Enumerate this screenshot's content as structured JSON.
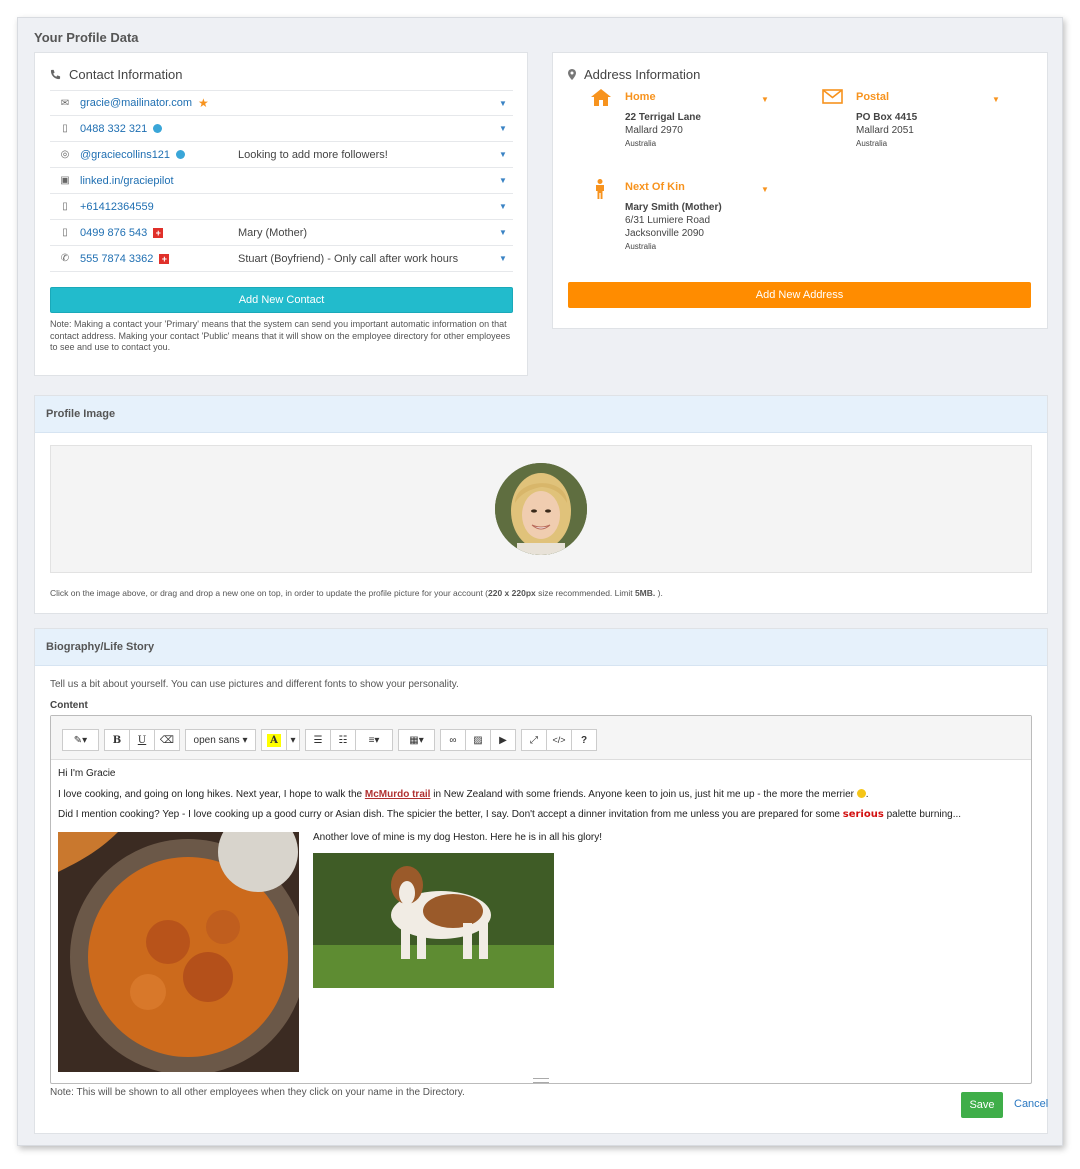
{
  "page": {
    "title": "Your Profile Data"
  },
  "contact": {
    "heading": "Contact Information",
    "rows": [
      {
        "icon": "envelope-icon",
        "value": "gracie@mailinator.com",
        "badge": "star",
        "note": ""
      },
      {
        "icon": "mobile-icon",
        "value": "0488 332 321",
        "badge": "globe",
        "note": ""
      },
      {
        "icon": "instagram-icon",
        "value": "@graciecollins121",
        "badge": "globe",
        "note": "Looking to add more followers!"
      },
      {
        "icon": "linkedin-icon",
        "value": "linked.in/graciepilot",
        "badge": "",
        "note": ""
      },
      {
        "icon": "mobile-icon",
        "value": "+61412364559",
        "badge": "",
        "note": ""
      },
      {
        "icon": "mobile-icon",
        "value": "0499 876 543",
        "badge": "emergency",
        "note": "Mary (Mother)"
      },
      {
        "icon": "phone-icon",
        "value": "555 7874 3362",
        "badge": "emergency",
        "note": "Stuart (Boyfriend) - Only call after work hours"
      }
    ],
    "add_button": "Add New Contact",
    "note": "Note: Making a contact your 'Primary' means that the system can send you important automatic information on that contact address. Making your contact 'Public' means that it will show on the employee directory for other employees to see and use to contact you."
  },
  "address": {
    "heading": "Address Information",
    "home": {
      "title": "Home",
      "line1": "22 Terrigal Lane",
      "line2": "Mallard 2970",
      "country": "Australia"
    },
    "postal": {
      "title": "Postal",
      "line1": "PO Box 4415",
      "line2": "Mallard 2051",
      "country": "Australia"
    },
    "kin": {
      "title": "Next Of Kin",
      "line1": "Mary Smith (Mother)",
      "line2": "6/31 Lumiere Road",
      "line3": "Jacksonville 2090",
      "country": "Australia"
    },
    "add_button": "Add New Address"
  },
  "profile_image": {
    "heading": "Profile Image",
    "help_prefix": "Click on the image above, or drag and drop a new one on top, in order to update the profile picture for your account (",
    "help_size": "220 x 220px",
    "help_mid": " size recommended. Limit ",
    "help_limit": "5MB.",
    "help_suffix": " )."
  },
  "bio": {
    "heading": "Biography/Life Story",
    "intro": "Tell us a bit about yourself. You can use pictures and different fonts to show your personality.",
    "content_label": "Content",
    "toolbar": {
      "font": "open sans",
      "bold": "B",
      "underline": "U",
      "help": "?"
    },
    "line1": "Hi I'm Gracie",
    "line2a": "I love cooking, and going on long hikes.  Next year, I hope to walk the ",
    "line2_link": "McMurdo trail",
    "line2b": " in New Zealand with some friends. Anyone keen to join us, just hit me up - the more the merrier ",
    "line2c": ".",
    "line3a": "Did I mention cooking? Yep - I love cooking up a good curry or Asian dish. The spicier the better, I say.  Don't accept a dinner invitation from me unless you are prepared for some ",
    "line3_em": "serious",
    "line3b": " palette burning...",
    "dog_caption": "Another love of mine is my dog Heston.  Here he is in all his glory!",
    "footer_note": "Note: This will be shown to all other employees when they click on your name in the Directory."
  },
  "actions": {
    "save": "Save",
    "cancel": "Cancel"
  },
  "colors": {
    "accent_teal": "#22bbcc",
    "accent_orange": "#ff8c00",
    "save_green": "#3fae49",
    "link_blue": "#1f6fb2"
  }
}
